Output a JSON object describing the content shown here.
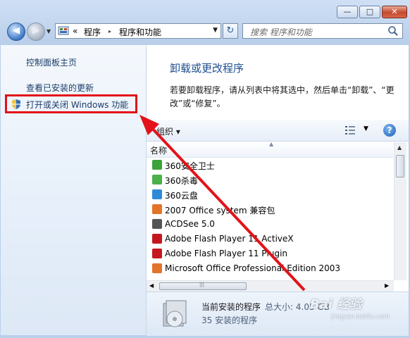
{
  "window": {
    "min_glyph": "—",
    "max_glyph": "□",
    "close_glyph": "✕"
  },
  "nav": {
    "back_glyph": "◀",
    "forward_glyph": "▶",
    "history_glyph": "▼",
    "refresh_glyph": "↻"
  },
  "address": {
    "prefix": "«",
    "crumbs": [
      "程序",
      "程序和功能"
    ],
    "separator": "▸",
    "dropdown_glyph": "▼"
  },
  "search": {
    "placeholder": "搜索 程序和功能"
  },
  "sidebar": {
    "items": [
      {
        "label": "控制面板主页"
      },
      {
        "label": "查看已安装的更新"
      },
      {
        "label": "打开或关闭 Windows 功能"
      }
    ]
  },
  "main": {
    "title": "卸载或更改程序",
    "description": "若要卸载程序，请从列表中将其选中，然后单击“卸载”、“更改”或“修复”。"
  },
  "toolbar": {
    "organize_label": "组织 ▾",
    "view_dropdown": "▼",
    "help_glyph": "?"
  },
  "list": {
    "column_name": "名称",
    "sort_glyph": "▲",
    "rows": [
      {
        "name": "360安全卫士",
        "icon": "360-safeguard-icon",
        "color": "#3aa33a"
      },
      {
        "name": "360杀毒",
        "icon": "360-antivirus-icon",
        "color": "#4bb04a"
      },
      {
        "name": "360云盘",
        "icon": "360-cloud-icon",
        "color": "#2f8ad8"
      },
      {
        "name": "2007 Office system 兼容包",
        "icon": "office-compat-icon",
        "color": "#e2742a"
      },
      {
        "name": "ACDSee 5.0",
        "icon": "acdsee-icon",
        "color": "#555555"
      },
      {
        "name": "Adobe Flash Player 11 ActiveX",
        "icon": "flash-icon",
        "color": "#c4161c"
      },
      {
        "name": "Adobe Flash Player 11 Plugin",
        "icon": "flash-icon",
        "color": "#c4161c"
      },
      {
        "name": "Microsoft Office Professional Edition 2003",
        "icon": "office-icon",
        "color": "#e2742a"
      }
    ],
    "scroll_up": "▲",
    "scroll_left": "◀",
    "scroll_right": "▶",
    "scroll_grip": "|||"
  },
  "details": {
    "line1": "当前安装的程序",
    "total_size": "总大小: 4.05 GB",
    "line2": "35 安装的程序"
  },
  "watermark": {
    "brand": "Bai 经验",
    "sub": "jingyan.baidu.com"
  },
  "colors": {
    "annotation": "#e3121a",
    "link": "#1a3c68",
    "title": "#1e4f8f"
  }
}
